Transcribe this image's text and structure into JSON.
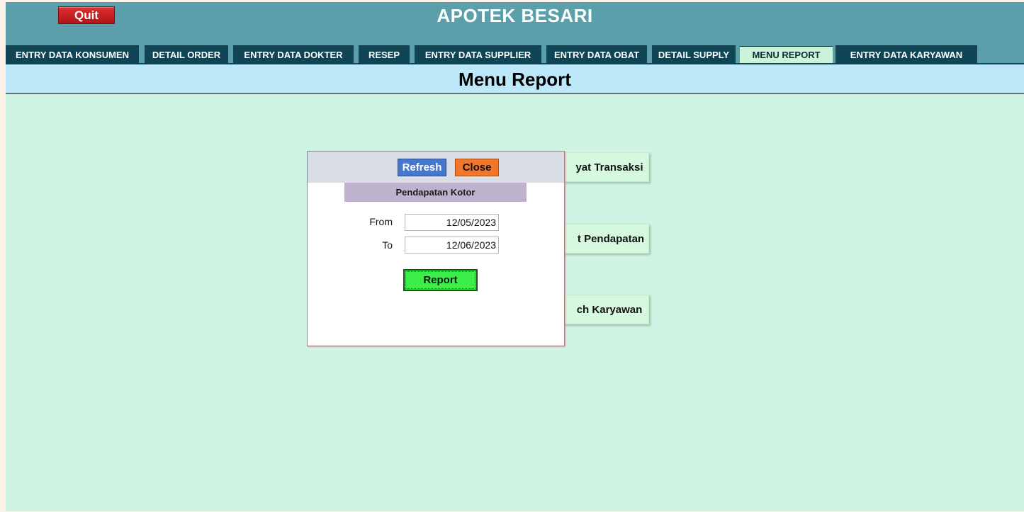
{
  "app": {
    "title": "APOTEK BESARI",
    "quit_label": "Quit"
  },
  "tabs": [
    {
      "label": "ENTRY DATA KONSUMEN"
    },
    {
      "label": "DETAIL ORDER"
    },
    {
      "label": "ENTRY DATA DOKTER"
    },
    {
      "label": "RESEP"
    },
    {
      "label": "ENTRY DATA SUPPLIER"
    },
    {
      "label": "ENTRY DATA OBAT"
    },
    {
      "label": "DETAIL SUPPLY"
    },
    {
      "label": "MENU REPORT",
      "active": true
    },
    {
      "label": "ENTRY DATA KARYAWAN"
    }
  ],
  "page": {
    "title": "Menu Report"
  },
  "report_buttons": [
    {
      "label": "yat Transaksi"
    },
    {
      "label": "t Pendapatan"
    },
    {
      "label": "ch Karyawan"
    }
  ],
  "dialog": {
    "refresh_label": "Refresh",
    "close_label": "Close",
    "subtitle": "Pendapatan Kotor",
    "from_label": "From",
    "from_value": "12/05/2023",
    "to_label": "To",
    "to_value": "12/06/2023",
    "report_label": "Report"
  },
  "colors": {
    "topbar": "#5a9fa9",
    "tab": "#0f4555",
    "tab_active": "#c9f4d9",
    "content_bg": "#cff4e3",
    "header_band": "#bde8fa"
  }
}
